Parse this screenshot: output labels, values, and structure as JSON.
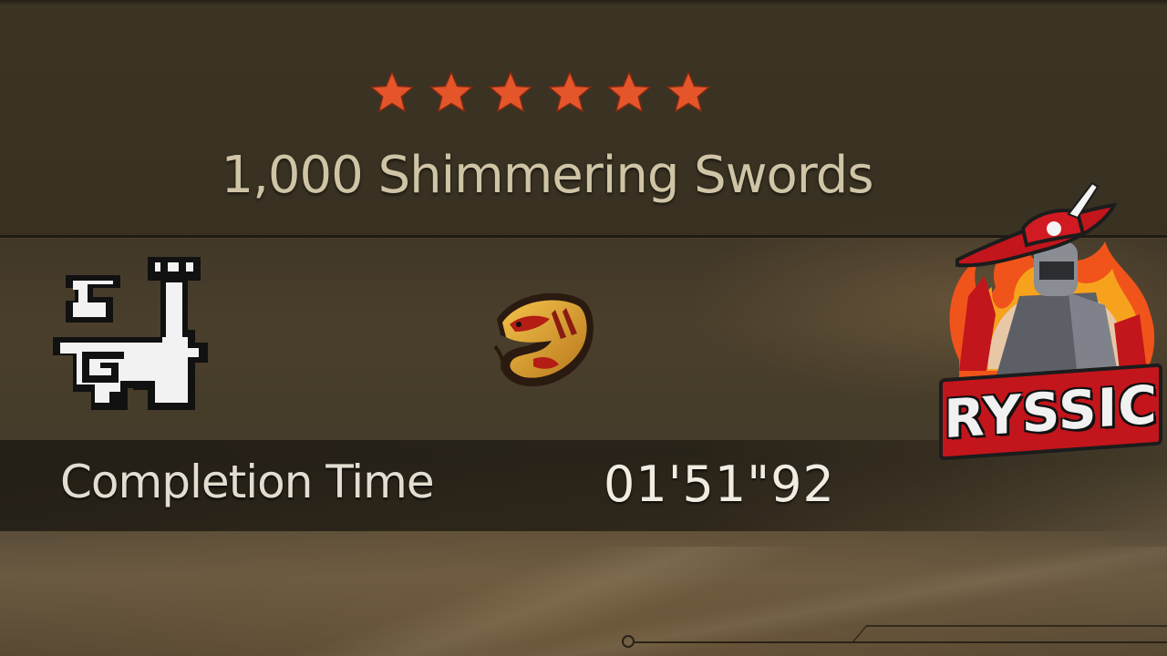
{
  "quest": {
    "rank_stars": 6,
    "title": "1,000 Shimmering Swords"
  },
  "icons": {
    "weapon": "hunting-horn-icon",
    "monster": "monster-icon",
    "star": "star-icon"
  },
  "results": {
    "completion_time_label": "Completion Time",
    "completion_time_value": "01'51\"92"
  },
  "watermark": {
    "text": "RYSSIC"
  },
  "colors": {
    "star": "#e4552a",
    "title_text": "#cfc5a6",
    "logo_red": "#c3151c"
  }
}
